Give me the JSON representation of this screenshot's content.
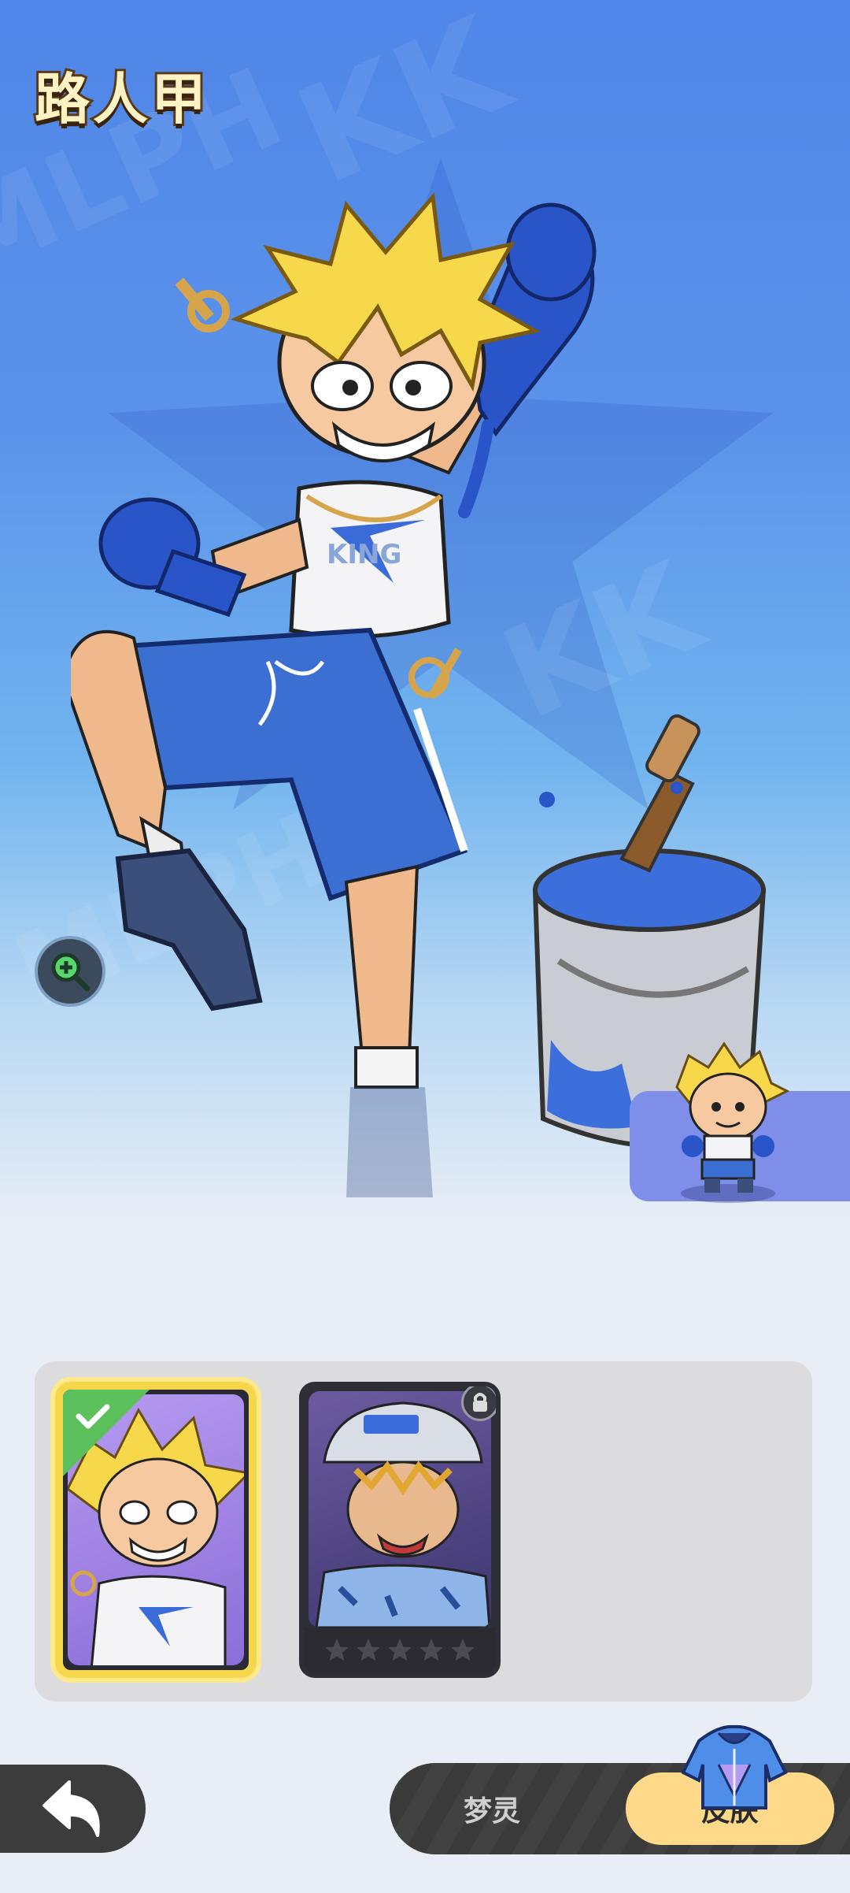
{
  "header": {
    "title": "路人甲"
  },
  "skins": {
    "items": [
      {
        "name": "default",
        "selected": true,
        "locked": false
      },
      {
        "name": "hat",
        "selected": false,
        "locked": true,
        "stars": 5
      }
    ]
  },
  "bottom_nav": {
    "tabs": [
      {
        "label": "梦灵",
        "active": false
      },
      {
        "label": "皮肤",
        "active": true
      }
    ]
  },
  "colors": {
    "accent": "#ffd98a",
    "selected_border": "#f6d64a",
    "check": "#5cc05c",
    "hero_blue": "#4f86e8"
  },
  "watermark": [
    "KK",
    "MLPH",
    "KING"
  ]
}
